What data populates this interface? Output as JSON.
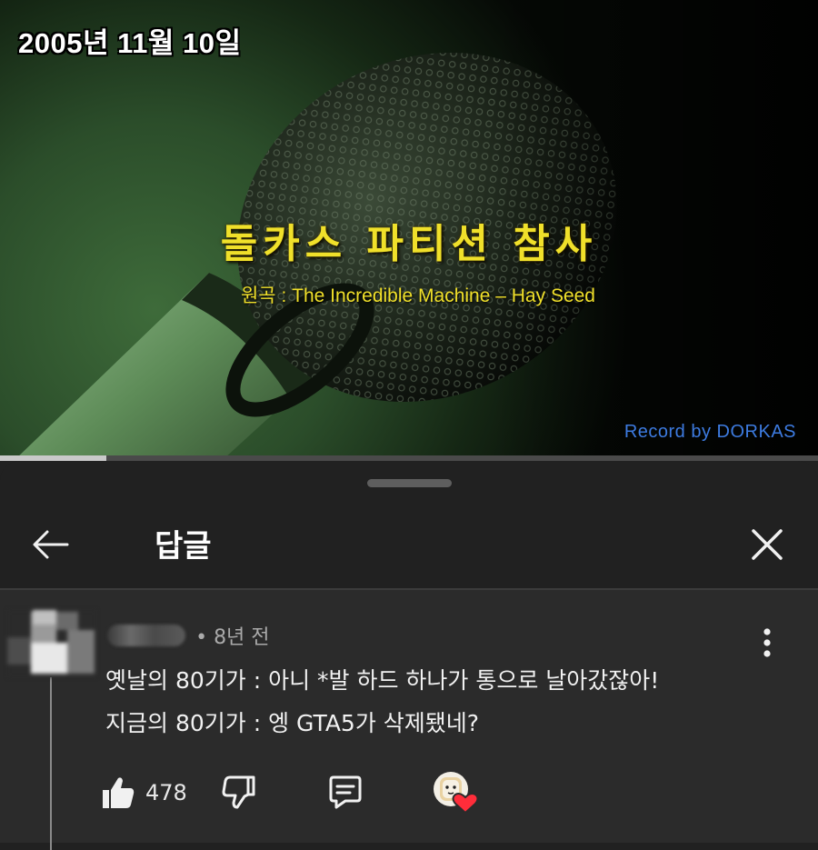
{
  "video": {
    "date_overlay": "2005년 11월 10일",
    "title_overlay": "돌카스 파티션 참사",
    "subtitle_overlay": "원곡 : The Incredible Machine – Hay Seed",
    "record_credit": "Record by DORKAS",
    "progress_fraction": 0.13,
    "accent_color": "#f0e02a"
  },
  "panel": {
    "title": "답글",
    "back_icon": "arrow-left-icon",
    "close_icon": "close-icon"
  },
  "comment": {
    "time": "• 8년 전",
    "lines": [
      "옛날의 80기가 : 아니 *발 하드 하나가 통으로 날아갔잖아!",
      "지금의 80기가 : 엥 GTA5가 삭제됐네?"
    ],
    "like_count": "478",
    "icons": {
      "like": "thumbs-up-icon",
      "dislike": "thumbs-down-icon",
      "reply": "reply-icon",
      "creator_heart": "creator-heart-icon",
      "more": "more-vert-icon"
    }
  }
}
